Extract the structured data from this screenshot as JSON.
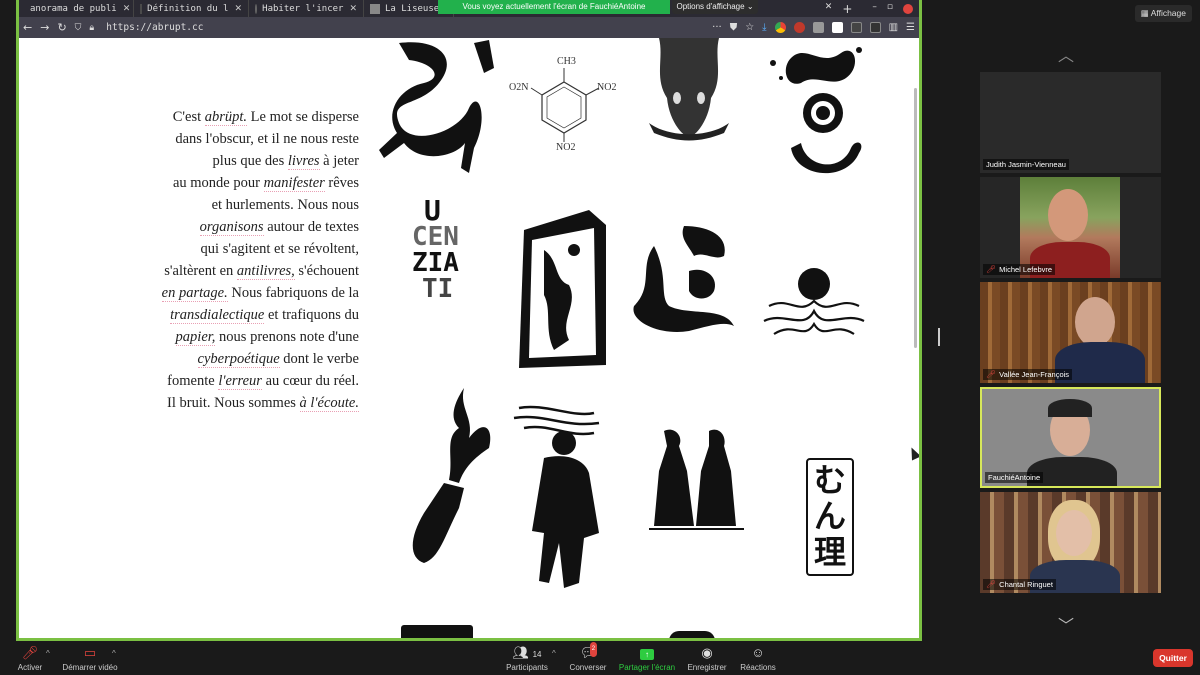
{
  "browser": {
    "tabs": [
      {
        "label": "anorama de publi"
      },
      {
        "label": "Définition du l"
      },
      {
        "label": "Habiter l'incer"
      },
      {
        "label": "La Liseuse"
      }
    ],
    "url": "https://abrupt.cc",
    "new_tab": "+"
  },
  "share_banner": {
    "text": "Vous voyez actuellement l'écran de FauchiéAntoine",
    "options_label": "Options d'affichage"
  },
  "poem": {
    "lines": [
      [
        "C'est ",
        "abrüpt.",
        " Le mot se disperse"
      ],
      [
        "dans l'obscur, et il ne nous reste"
      ],
      [
        "plus que des ",
        "livres",
        " à jeter"
      ],
      [
        "au monde pour ",
        "manifester",
        " rêves"
      ],
      [
        "et hurlements. Nous nous"
      ],
      [
        "organisons",
        " autour de textes"
      ],
      [
        "qui s'agitent et se révoltent,"
      ],
      [
        "s'altèrent en ",
        "antilivres,",
        " s'échouent"
      ],
      [
        "en partage.",
        " Nous fabriquons de la"
      ],
      [
        "transdialectique",
        " et trafiquons du"
      ],
      [
        "papier,",
        " nous prenons note d'une"
      ],
      [
        "cyberpoétique",
        " dont le verbe"
      ],
      [
        "fomente ",
        "l'erreur",
        " au cœur du réel."
      ],
      [
        "Il bruit. Nous sommes ",
        "à l'écoute."
      ]
    ]
  },
  "art": {
    "chem_labels": {
      "ch3": "CH3",
      "o2n": "O2N",
      "no2_right": "NO2",
      "no2_bottom": "NO2"
    },
    "letters_word": [
      "U",
      "CEN",
      "ZIA",
      "TI"
    ],
    "japanese": [
      "む",
      "ん",
      "理"
    ]
  },
  "sidebar": {
    "view_button": "Affichage",
    "participants": [
      {
        "name": "Judith Jasmin-Vienneau",
        "muted": false
      },
      {
        "name": "Michel Lefebvre",
        "muted": true
      },
      {
        "name": "Vallée Jean-François",
        "muted": true
      },
      {
        "name": "FauchiéAntoine",
        "muted": false
      },
      {
        "name": "Chantal Ringuet",
        "muted": true
      }
    ]
  },
  "toolbar": {
    "mute": "Activer",
    "video": "Démarrer vidéo",
    "participants": "Participants",
    "participants_count": "14",
    "chat": "Converser",
    "chat_badge": "2",
    "share": "Partager l'écran",
    "record": "Enregistrer",
    "reactions": "Réactions",
    "quit": "Quitter"
  },
  "colors": {
    "share_border": "#7bc043",
    "active_speaker": "#d7e85a",
    "quit": "#d9362c",
    "banner": "#22b14c"
  }
}
